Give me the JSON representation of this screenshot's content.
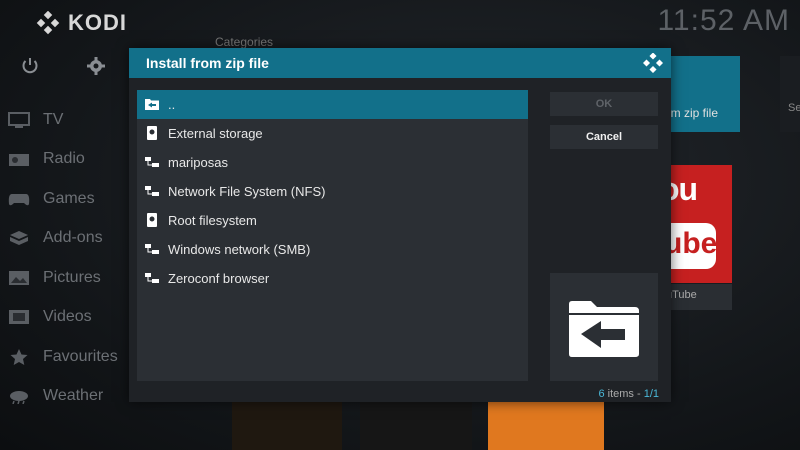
{
  "app": {
    "name": "KODI",
    "clock": "11:52 AM"
  },
  "sidebar": {
    "items": [
      {
        "label": "TV",
        "icon": "tv-icon"
      },
      {
        "label": "Radio",
        "icon": "radio-icon"
      },
      {
        "label": "Games",
        "icon": "gamepad-icon"
      },
      {
        "label": "Add-ons",
        "icon": "addons-box-icon"
      },
      {
        "label": "Pictures",
        "icon": "pictures-icon"
      },
      {
        "label": "Videos",
        "icon": "film-icon"
      },
      {
        "label": "Favourites",
        "icon": "star-icon"
      },
      {
        "label": "Weather",
        "icon": "weather-icon"
      }
    ]
  },
  "background": {
    "categories_label": "Categories",
    "tile_zip_label": "om zip file",
    "tile_s_label": "Se",
    "youtube": {
      "top": "ou",
      "bottom": "ube",
      "label": "uTube"
    }
  },
  "dialog": {
    "title": "Install from zip file",
    "items": [
      {
        "label": "..",
        "icon": "folder-back-icon",
        "selected": true
      },
      {
        "label": "External storage",
        "icon": "hard-drive-icon",
        "selected": false
      },
      {
        "label": "mariposas",
        "icon": "network-share-icon",
        "selected": false
      },
      {
        "label": "Network File System (NFS)",
        "icon": "network-share-icon",
        "selected": false
      },
      {
        "label": "Root filesystem",
        "icon": "hard-drive-icon",
        "selected": false
      },
      {
        "label": "Windows network (SMB)",
        "icon": "network-share-icon",
        "selected": false
      },
      {
        "label": "Zeroconf browser",
        "icon": "network-share-icon",
        "selected": false
      }
    ],
    "ok_label": "OK",
    "cancel_label": "Cancel",
    "count": {
      "items": "6",
      "items_word": "items",
      "sep": " - ",
      "page": "1/1"
    }
  },
  "colors": {
    "accent": "#12708a",
    "panel": "#1f2226",
    "list_bg": "#2b2f34"
  }
}
